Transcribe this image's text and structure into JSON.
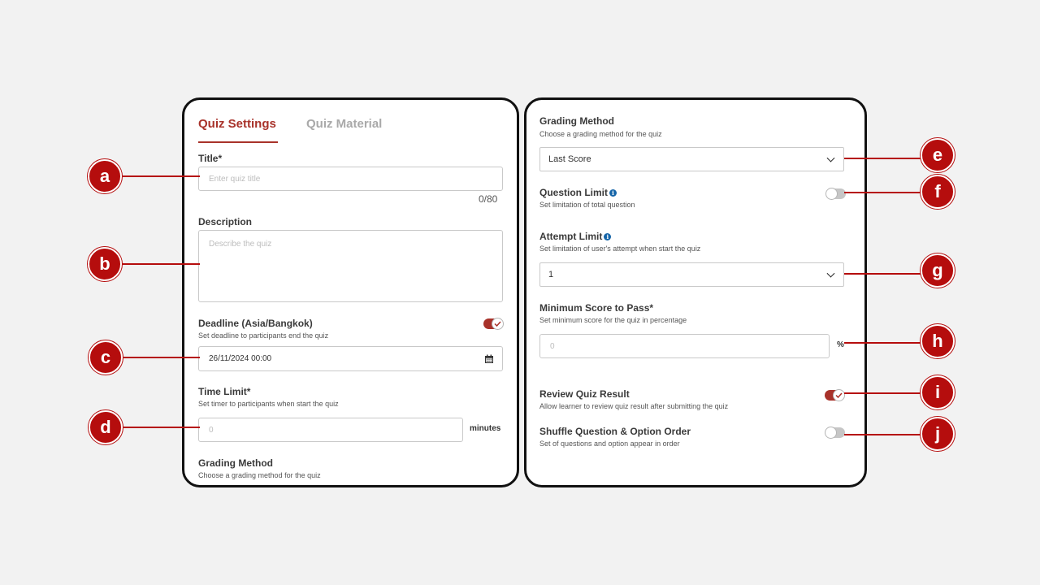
{
  "left": {
    "tabs": [
      {
        "label": "Quiz Settings"
      },
      {
        "label": "Quiz Material"
      }
    ],
    "title": {
      "label": "Title*",
      "placeholder": "Enter quiz title",
      "counter": "0/80"
    },
    "description": {
      "label": "Description",
      "placeholder": "Describe the quiz"
    },
    "deadline": {
      "label": "Deadline (Asia/Bangkok)",
      "hint": "Set deadline to participants end the quiz",
      "value": "26/11/2024 00:00",
      "toggle": "on",
      "icon": "calendar-icon"
    },
    "time_limit": {
      "label": "Time Limit*",
      "hint": "Set timer to participants when start the quiz",
      "placeholder": "0",
      "suffix": "minutes"
    },
    "grading": {
      "label": "Grading Method",
      "hint": "Choose a grading method for the quiz"
    }
  },
  "right": {
    "grading": {
      "label": "Grading Method",
      "hint": "Choose a grading method for the quiz",
      "value": "Last Score"
    },
    "question_limit": {
      "label": "Question Limit",
      "hint": "Set limitation of total question",
      "toggle": "off",
      "info": "i"
    },
    "attempt_limit": {
      "label": "Attempt Limit",
      "hint": "Set limitation of user's attempt when start the quiz",
      "value": "1",
      "info": "i"
    },
    "min_score": {
      "label": "Minimum Score to Pass*",
      "hint": "Set minimum score for the quiz in percentage",
      "placeholder": "0",
      "suffix": "%"
    },
    "review": {
      "label": "Review Quiz Result",
      "hint": "Allow learner to review quiz result after submitting the quiz",
      "toggle": "on"
    },
    "shuffle": {
      "label": "Shuffle Question & Option Order",
      "hint": "Set of questions and option appear in order",
      "toggle": "off"
    }
  },
  "callouts": [
    "a",
    "b",
    "c",
    "d",
    "e",
    "f",
    "g",
    "h",
    "i",
    "j"
  ],
  "colors": {
    "accent": "#a8322a",
    "callout": "#b50d0d",
    "info": "#1565a8"
  }
}
